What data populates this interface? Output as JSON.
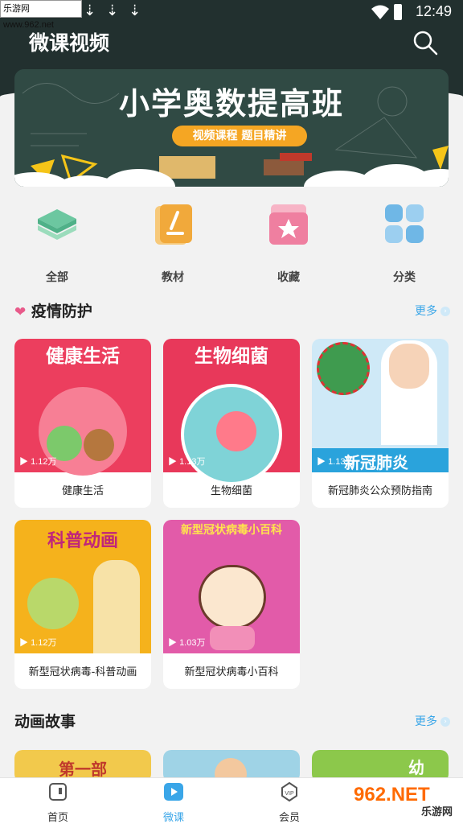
{
  "status": {
    "site": "乐游网 www.962.net",
    "time": "12:49"
  },
  "header": {
    "title": "微课视频"
  },
  "banner": {
    "title": "小学奥数提高班",
    "subtitle": "视频课程 题目精讲"
  },
  "quicknav": [
    {
      "label": "全部"
    },
    {
      "label": "教材"
    },
    {
      "label": "收藏"
    },
    {
      "label": "分类"
    }
  ],
  "section1": {
    "title": "疫情防护",
    "more": "更多",
    "cards": [
      {
        "thumb_text": "健康生活",
        "views": "1.12万",
        "name": "健康生活"
      },
      {
        "thumb_text": "生物细菌",
        "views": "1.13万",
        "name": "生物细菌"
      },
      {
        "thumb_text": "新冠肺炎",
        "views": "1.13万",
        "name": "新冠肺炎公众预防指南"
      },
      {
        "thumb_text": "科普动画",
        "views": "1.12万",
        "name": "新型冠状病毒-科普动画"
      },
      {
        "thumb_text": "新型冠状病毒小百科",
        "views": "1.03万",
        "name": "新型冠状病毒小百科"
      }
    ]
  },
  "section2": {
    "title": "动画故事",
    "more": "更多",
    "peek": [
      "第一部",
      "",
      "幼"
    ]
  },
  "bottomnav": [
    {
      "label": "首页"
    },
    {
      "label": "微课"
    },
    {
      "label": "会员"
    }
  ],
  "brand": {
    "text": "962.NET",
    "sub": "乐游网"
  },
  "colors": {
    "header": "#22302f",
    "accent": "#3aa6e8",
    "brand": "#ff6a00"
  }
}
